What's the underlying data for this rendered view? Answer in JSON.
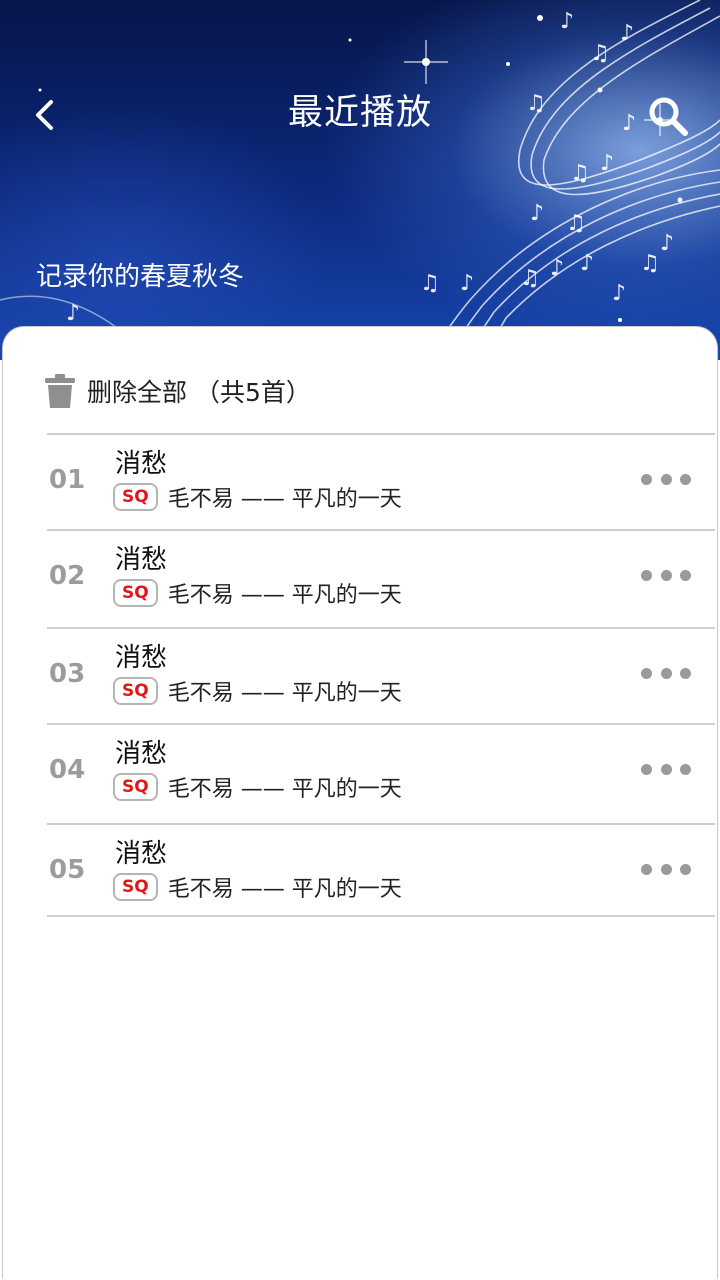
{
  "header": {
    "title": "最近播放",
    "tagline": "记录你的春夏秋冬",
    "back_icon": "chevron-left-icon",
    "search_icon": "search-icon"
  },
  "toolbar": {
    "delete_all_label": "删除全部 （共5首）",
    "delete_icon": "trash-icon"
  },
  "songs": [
    {
      "index": "01",
      "title": "消愁",
      "quality": "SQ",
      "artist_album": "毛不易 —— 平凡的一天"
    },
    {
      "index": "02",
      "title": "消愁",
      "quality": "SQ",
      "artist_album": "毛不易 —— 平凡的一天"
    },
    {
      "index": "03",
      "title": "消愁",
      "quality": "SQ",
      "artist_album": "毛不易 —— 平凡的一天"
    },
    {
      "index": "04",
      "title": "消愁",
      "quality": "SQ",
      "artist_album": "毛不易 —— 平凡的一天"
    },
    {
      "index": "05",
      "title": "消愁",
      "quality": "SQ",
      "artist_album": "毛不易 —— 平凡的一天"
    }
  ],
  "colors": {
    "header_dark": "#07154a",
    "header_light": "#1846b0",
    "quality_badge_text": "#e0161b",
    "index_gray": "#9c9c9c",
    "more_dots": "#9a9a9a"
  }
}
